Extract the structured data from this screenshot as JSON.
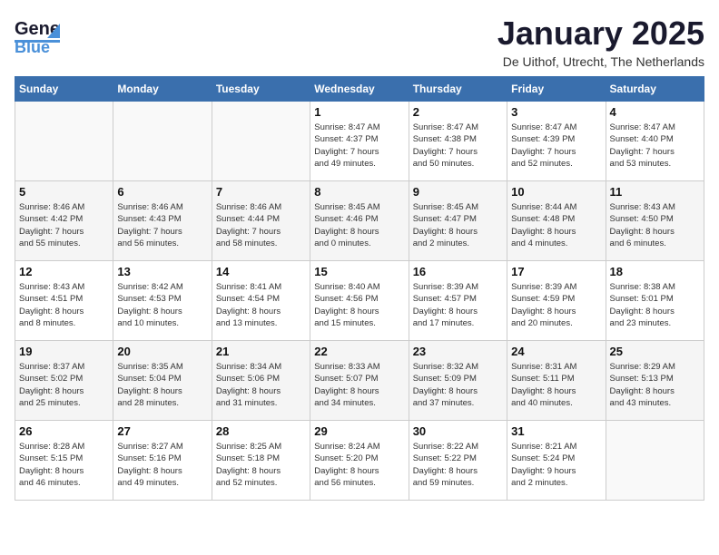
{
  "header": {
    "logo_general": "General",
    "logo_blue": "Blue",
    "month": "January 2025",
    "location": "De Uithof, Utrecht, The Netherlands"
  },
  "days_of_week": [
    "Sunday",
    "Monday",
    "Tuesday",
    "Wednesday",
    "Thursday",
    "Friday",
    "Saturday"
  ],
  "weeks": [
    [
      {
        "day": "",
        "info": ""
      },
      {
        "day": "",
        "info": ""
      },
      {
        "day": "",
        "info": ""
      },
      {
        "day": "1",
        "info": "Sunrise: 8:47 AM\nSunset: 4:37 PM\nDaylight: 7 hours\nand 49 minutes."
      },
      {
        "day": "2",
        "info": "Sunrise: 8:47 AM\nSunset: 4:38 PM\nDaylight: 7 hours\nand 50 minutes."
      },
      {
        "day": "3",
        "info": "Sunrise: 8:47 AM\nSunset: 4:39 PM\nDaylight: 7 hours\nand 52 minutes."
      },
      {
        "day": "4",
        "info": "Sunrise: 8:47 AM\nSunset: 4:40 PM\nDaylight: 7 hours\nand 53 minutes."
      }
    ],
    [
      {
        "day": "5",
        "info": "Sunrise: 8:46 AM\nSunset: 4:42 PM\nDaylight: 7 hours\nand 55 minutes."
      },
      {
        "day": "6",
        "info": "Sunrise: 8:46 AM\nSunset: 4:43 PM\nDaylight: 7 hours\nand 56 minutes."
      },
      {
        "day": "7",
        "info": "Sunrise: 8:46 AM\nSunset: 4:44 PM\nDaylight: 7 hours\nand 58 minutes."
      },
      {
        "day": "8",
        "info": "Sunrise: 8:45 AM\nSunset: 4:46 PM\nDaylight: 8 hours\nand 0 minutes."
      },
      {
        "day": "9",
        "info": "Sunrise: 8:45 AM\nSunset: 4:47 PM\nDaylight: 8 hours\nand 2 minutes."
      },
      {
        "day": "10",
        "info": "Sunrise: 8:44 AM\nSunset: 4:48 PM\nDaylight: 8 hours\nand 4 minutes."
      },
      {
        "day": "11",
        "info": "Sunrise: 8:43 AM\nSunset: 4:50 PM\nDaylight: 8 hours\nand 6 minutes."
      }
    ],
    [
      {
        "day": "12",
        "info": "Sunrise: 8:43 AM\nSunset: 4:51 PM\nDaylight: 8 hours\nand 8 minutes."
      },
      {
        "day": "13",
        "info": "Sunrise: 8:42 AM\nSunset: 4:53 PM\nDaylight: 8 hours\nand 10 minutes."
      },
      {
        "day": "14",
        "info": "Sunrise: 8:41 AM\nSunset: 4:54 PM\nDaylight: 8 hours\nand 13 minutes."
      },
      {
        "day": "15",
        "info": "Sunrise: 8:40 AM\nSunset: 4:56 PM\nDaylight: 8 hours\nand 15 minutes."
      },
      {
        "day": "16",
        "info": "Sunrise: 8:39 AM\nSunset: 4:57 PM\nDaylight: 8 hours\nand 17 minutes."
      },
      {
        "day": "17",
        "info": "Sunrise: 8:39 AM\nSunset: 4:59 PM\nDaylight: 8 hours\nand 20 minutes."
      },
      {
        "day": "18",
        "info": "Sunrise: 8:38 AM\nSunset: 5:01 PM\nDaylight: 8 hours\nand 23 minutes."
      }
    ],
    [
      {
        "day": "19",
        "info": "Sunrise: 8:37 AM\nSunset: 5:02 PM\nDaylight: 8 hours\nand 25 minutes."
      },
      {
        "day": "20",
        "info": "Sunrise: 8:35 AM\nSunset: 5:04 PM\nDaylight: 8 hours\nand 28 minutes."
      },
      {
        "day": "21",
        "info": "Sunrise: 8:34 AM\nSunset: 5:06 PM\nDaylight: 8 hours\nand 31 minutes."
      },
      {
        "day": "22",
        "info": "Sunrise: 8:33 AM\nSunset: 5:07 PM\nDaylight: 8 hours\nand 34 minutes."
      },
      {
        "day": "23",
        "info": "Sunrise: 8:32 AM\nSunset: 5:09 PM\nDaylight: 8 hours\nand 37 minutes."
      },
      {
        "day": "24",
        "info": "Sunrise: 8:31 AM\nSunset: 5:11 PM\nDaylight: 8 hours\nand 40 minutes."
      },
      {
        "day": "25",
        "info": "Sunrise: 8:29 AM\nSunset: 5:13 PM\nDaylight: 8 hours\nand 43 minutes."
      }
    ],
    [
      {
        "day": "26",
        "info": "Sunrise: 8:28 AM\nSunset: 5:15 PM\nDaylight: 8 hours\nand 46 minutes."
      },
      {
        "day": "27",
        "info": "Sunrise: 8:27 AM\nSunset: 5:16 PM\nDaylight: 8 hours\nand 49 minutes."
      },
      {
        "day": "28",
        "info": "Sunrise: 8:25 AM\nSunset: 5:18 PM\nDaylight: 8 hours\nand 52 minutes."
      },
      {
        "day": "29",
        "info": "Sunrise: 8:24 AM\nSunset: 5:20 PM\nDaylight: 8 hours\nand 56 minutes."
      },
      {
        "day": "30",
        "info": "Sunrise: 8:22 AM\nSunset: 5:22 PM\nDaylight: 8 hours\nand 59 minutes."
      },
      {
        "day": "31",
        "info": "Sunrise: 8:21 AM\nSunset: 5:24 PM\nDaylight: 9 hours\nand 2 minutes."
      },
      {
        "day": "",
        "info": ""
      }
    ]
  ]
}
